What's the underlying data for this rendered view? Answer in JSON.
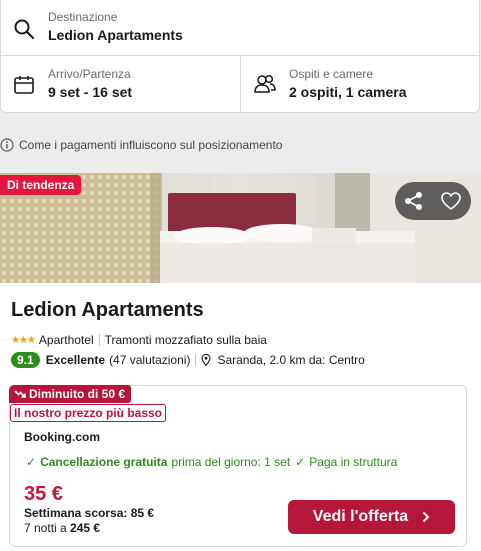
{
  "search": {
    "destination_label": "Destinazione",
    "destination_value": "Ledion Apartaments",
    "dates_label": "Arrivo/Partenza",
    "dates_value": "9 set - 16 set",
    "guests_label": "Ospiti e camere",
    "guests_value": "2 ospiti, 1 camera"
  },
  "info": {
    "ranking_text": "Come i pagamenti influiscono sul posizionamento"
  },
  "hotel": {
    "trend_badge": "Di tendenza",
    "name": "Ledion Apartaments",
    "star_rating": 3,
    "type": "Aparthotel",
    "tagline": "Tramonti mozzafiato sulla baia",
    "score": "9.1",
    "rating_label": "Excellente",
    "reviews": "(47 valutazioni)",
    "location": "Saranda, 2.0 km da: Centro"
  },
  "offer": {
    "drop_badge": "Diminuito di 50 €",
    "lowest_badge": "Il nostro prezzo più basso",
    "provider": "Booking.com",
    "cancel_strong": "Cancellazione gratuita",
    "cancel_detail": "prima del giorno: 1 set",
    "pay_on_site": "Paga in struttura",
    "price": "35 €",
    "last_week": "Settimana scorsa: 85 €",
    "nights_prefix": "7 notti a",
    "nights_total": "245 €",
    "cta_label": "Vedi l'offerta"
  },
  "icons": {
    "search": "search-icon",
    "calendar": "calendar-icon",
    "guests": "guests-icon",
    "info": "info-icon",
    "share": "share-icon",
    "favorite": "heart-icon",
    "location": "location-pin-icon",
    "trend_down": "trend-down-icon",
    "chevron": "chevron-right-icon"
  },
  "colors": {
    "accent": "#b6163a",
    "trend": "#e3173e",
    "score": "#2e8b1d",
    "price": "#c8163a",
    "stars": "#ff9c00"
  }
}
